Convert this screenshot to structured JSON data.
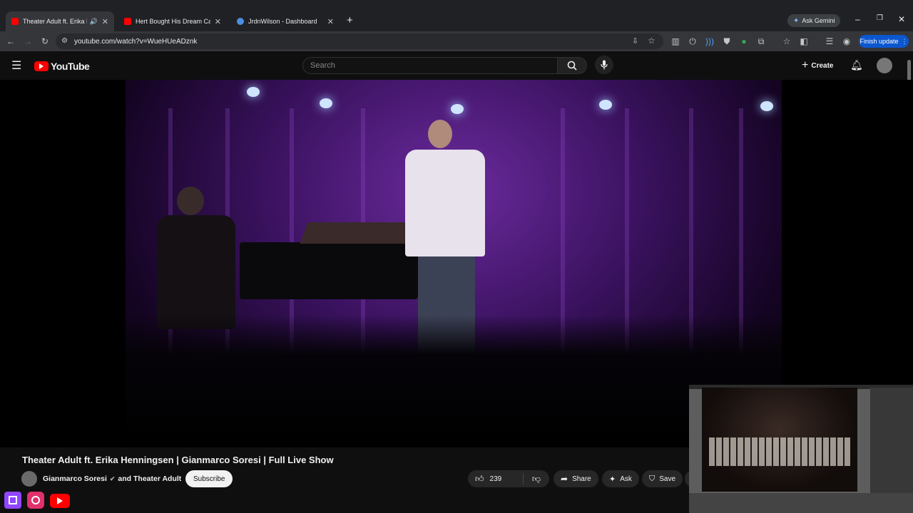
{
  "browser": {
    "tabs": [
      {
        "label": "Theater Adult ft. Erika Henn",
        "active": true
      },
      {
        "label": "Hert Bought His Dream Car",
        "active": false
      },
      {
        "label": "JrdnWilson - Dashboard",
        "active": false
      }
    ],
    "ask_gemini": "Ask Gemini",
    "url": "youtube.com/watch?v=WueHUeADznk",
    "finish_update": "Finish update"
  },
  "youtube": {
    "logo_text": "YouTube",
    "search_placeholder": "Search",
    "create_label": "Create"
  },
  "video": {
    "title": "Theater Adult ft. Erika Henningsen | Gianmarco Soresi | Full Live Show",
    "channel": "Gianmarco Soresi",
    "channel_and": "and Theater Adult",
    "subscribe_label": "Subscribe",
    "likes": "239",
    "share_label": "Share",
    "ask_label": "Ask",
    "save_label": "Save"
  },
  "colors": {
    "yt_red": "#ff0000",
    "finish_update_bg": "#0b57d0",
    "twitch": "#9146ff",
    "instagram": "#e1306c"
  },
  "icons": {
    "overlay": [
      "twitch-icon",
      "instagram-icon",
      "youtube-icon"
    ]
  }
}
